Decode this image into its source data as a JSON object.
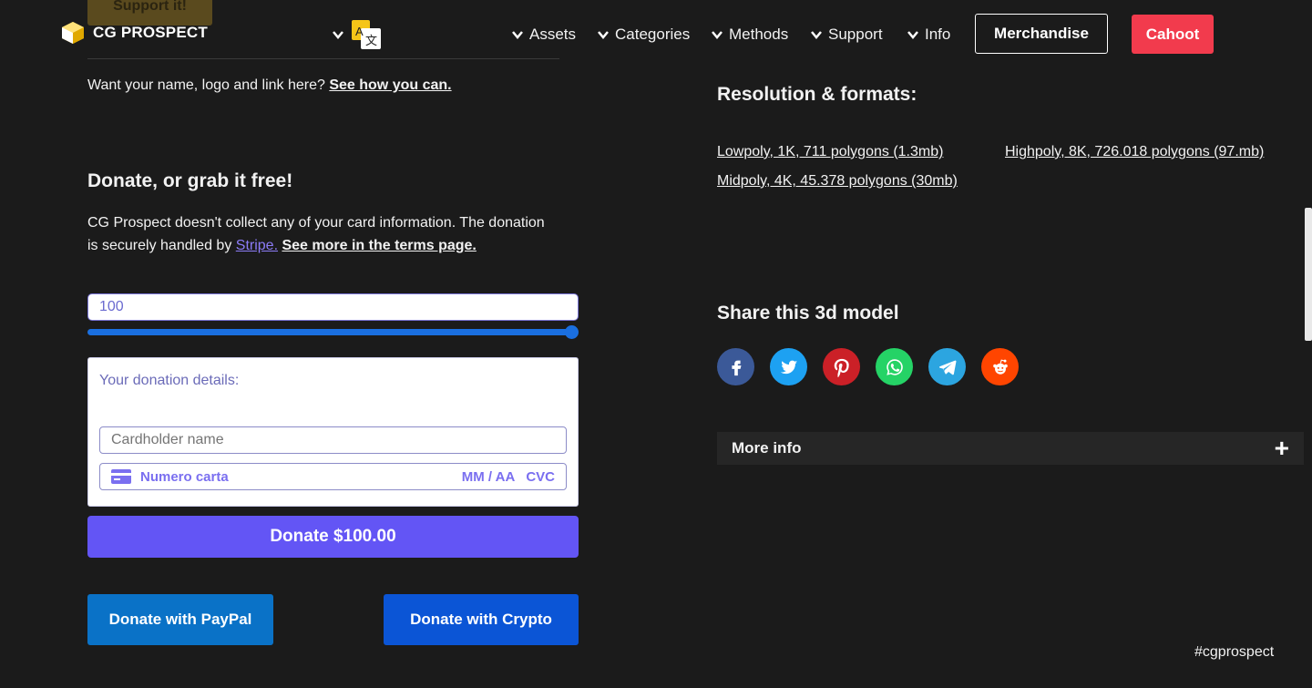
{
  "header": {
    "support_peek": "Support it!",
    "logo_text": "CG PROSPECT",
    "nav": [
      {
        "label": "Assets"
      },
      {
        "label": "Categories"
      },
      {
        "label": "Methods"
      },
      {
        "label": "Support"
      },
      {
        "label": "Info"
      }
    ],
    "merchandise": "Merchandise",
    "cahoot": "Cahoot",
    "language_icon": "translate-icon"
  },
  "sponsor": {
    "text": "Want your name, logo and link here?",
    "link": "See how you can."
  },
  "donate": {
    "heading": "Donate, or grab it free!",
    "p1": "CG Prospect doesn't collect any of your card information. The donation is securely handled by",
    "stripe": "Stripe.",
    "terms": "See more in the terms page.",
    "amount": "100",
    "slider_fraction": 1.0,
    "details_label": "Your donation details:",
    "cardholder_placeholder": "Cardholder name",
    "card_number_placeholder": "Numero carta",
    "expiry_placeholder": "MM / AA",
    "cvc_placeholder": "CVC",
    "donate_button": "Donate $100.00",
    "paypal_button": "Donate with PayPal",
    "crypto_button": "Donate with Crypto"
  },
  "resolution": {
    "heading": "Resolution & formats:",
    "links": [
      "Lowpoly, 1K, 711 polygons (1.3mb)",
      "Highpoly, 8K, 726.018 polygons (97.mb)",
      "Midpoly, 4K, 45.378 polygons (30mb)"
    ]
  },
  "share": {
    "heading": "Share this 3d model",
    "icons": [
      {
        "name": "facebook-icon",
        "color": "#3b5998"
      },
      {
        "name": "twitter-icon",
        "color": "#1da1f2"
      },
      {
        "name": "pinterest-icon",
        "color": "#cb2027"
      },
      {
        "name": "whatsapp-icon",
        "color": "#25d366"
      },
      {
        "name": "telegram-icon",
        "color": "#2ca5e0"
      },
      {
        "name": "reddit-icon",
        "color": "#ff4500"
      }
    ]
  },
  "more_info": {
    "label": "More info",
    "toggle": "+"
  },
  "footer": {
    "hashtag": "#cgprospect"
  },
  "colors": {
    "background": "#1b1b1b",
    "cahoot": "#f23b4d",
    "donate_button": "#6355f5",
    "paypal": "#0a72c7",
    "crypto": "#0b55d6",
    "slider": "#1a6fe0"
  }
}
